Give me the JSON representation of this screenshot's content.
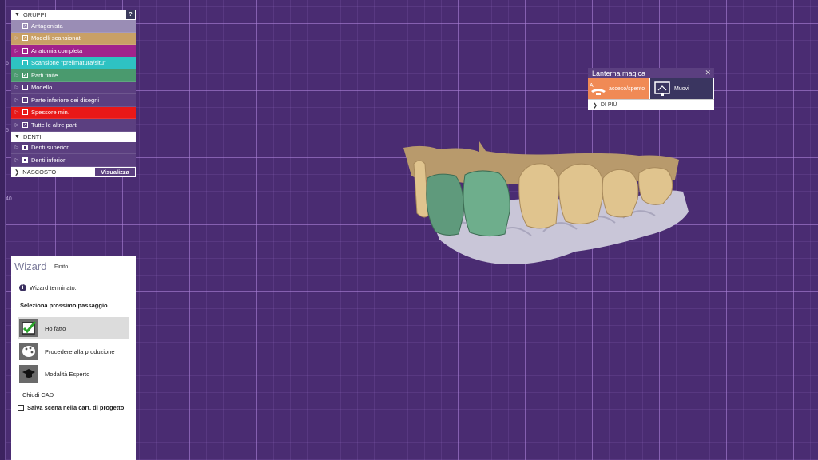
{
  "ruler": {
    "labels": [
      "6",
      "5",
      "40"
    ]
  },
  "groups": {
    "header": "GRUPPI",
    "help": "?",
    "items": [
      {
        "label": "Antagonista",
        "checked": true,
        "bg": "#9a8db5",
        "expandable": false
      },
      {
        "label": "Modelli scansionati",
        "checked": true,
        "bg": "#c9a066",
        "expandable": true
      },
      {
        "label": "Anatomia completa",
        "checked": false,
        "bg": "#a1238c",
        "expandable": true
      },
      {
        "label": "Scansione \"prelimatura/situ\"",
        "checked": false,
        "bg": "#2ec2c2",
        "expandable": false
      },
      {
        "label": "Parti finite",
        "checked": true,
        "bg": "#4a9a6e",
        "expandable": true
      },
      {
        "label": "Modello",
        "checked": false,
        "bg": "#5b3f80",
        "expandable": true
      },
      {
        "label": "Parte inferiore dei disegni",
        "checked": false,
        "bg": "#5b3f80",
        "expandable": true
      },
      {
        "label": "Spessore min.",
        "checked": false,
        "bg": "#e81818",
        "expandable": true
      },
      {
        "label": "Tutte le altre parti",
        "checked": true,
        "bg": "#5b3f80",
        "expandable": true
      }
    ]
  },
  "denti": {
    "header": "DENTI",
    "items": [
      {
        "label": "Denti superiori",
        "bg": "#5b3f80"
      },
      {
        "label": "Denti inferiori",
        "bg": "#5b3f80"
      }
    ]
  },
  "footer": {
    "hidden_label": "NASCOSTO",
    "view_label": "Visualizza"
  },
  "wizard": {
    "title": "Wizard",
    "tab": "Finito",
    "info": "Wizard terminato.",
    "next_step": "Seleziona prossimo passaggio",
    "options": [
      {
        "label": "Ho fatto",
        "icon": "checkmark-icon",
        "selected": true
      },
      {
        "label": "Procedere alla produzione",
        "icon": "palette-icon",
        "selected": false
      },
      {
        "label": "Modalità Esperto",
        "icon": "graduation-cap-icon",
        "selected": false
      }
    ],
    "close": "Chiudi CAD",
    "save": "Salva scena nella cart. di progetto"
  },
  "lanterna": {
    "title": "Lanterna magica",
    "on_off": "acceso/spento",
    "move": "Muovi",
    "more": "DI PIÙ"
  },
  "colors": {
    "background": "#4a2c72",
    "panel": "#5b3f80",
    "accent": "#f08a55"
  }
}
